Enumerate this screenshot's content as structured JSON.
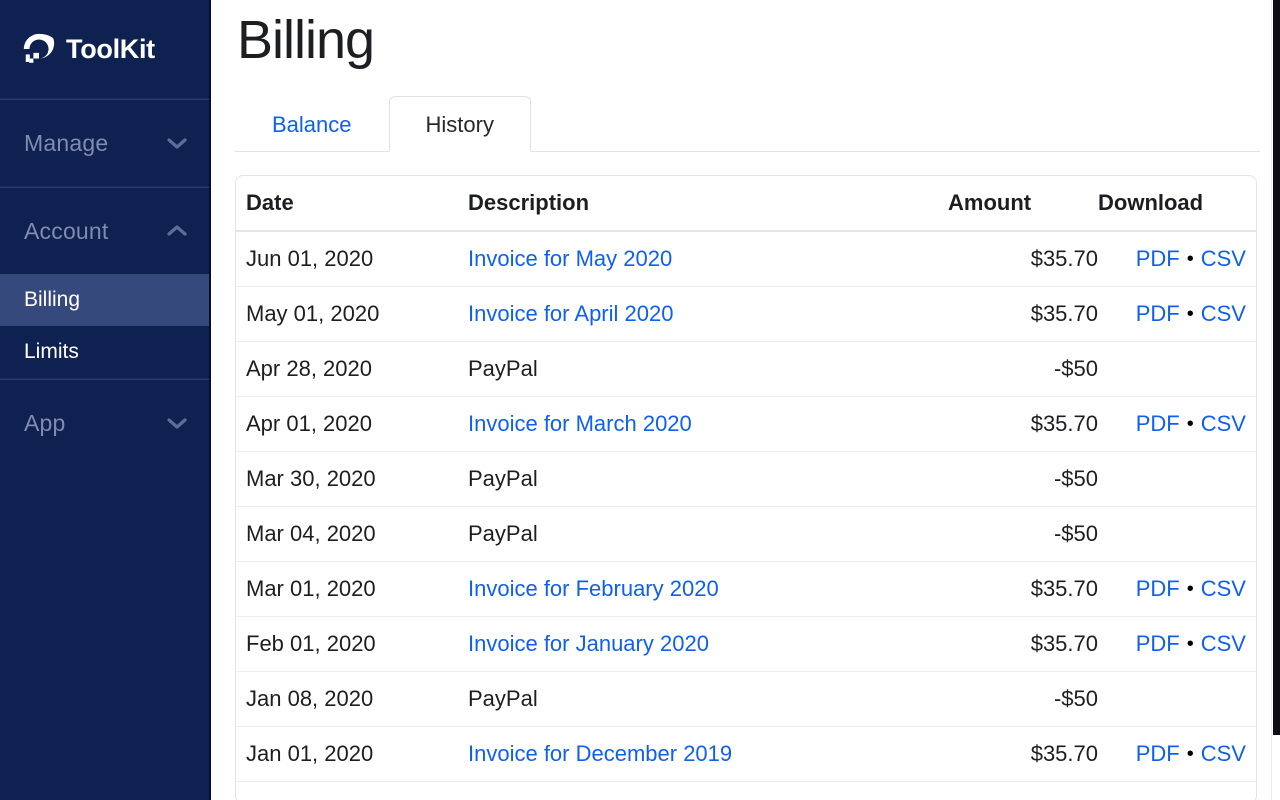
{
  "brand": {
    "name": "ToolKit",
    "logo_icon": "digitalocean-logo-icon"
  },
  "sidebar": {
    "groups": [
      {
        "label": "Manage",
        "icon": "chevron-down-icon",
        "expanded": false,
        "items": []
      },
      {
        "label": "Account",
        "icon": "chevron-up-icon",
        "expanded": true,
        "items": [
          {
            "label": "Billing",
            "active": true
          },
          {
            "label": "Limits",
            "active": false
          }
        ]
      },
      {
        "label": "App",
        "icon": "chevron-down-icon",
        "expanded": false,
        "items": []
      }
    ]
  },
  "page": {
    "title": "Billing"
  },
  "tabs": [
    {
      "label": "Balance",
      "active": false
    },
    {
      "label": "History",
      "active": true
    }
  ],
  "table": {
    "columns": [
      "Date",
      "Description",
      "Amount",
      "Download"
    ],
    "download_separator": "•",
    "rows": [
      {
        "date": "Jun 01, 2020",
        "description": "Invoice for May 2020",
        "description_link": true,
        "amount": "$35.70",
        "pdf": "PDF",
        "csv": "CSV"
      },
      {
        "date": "May 01, 2020",
        "description": "Invoice for April 2020",
        "description_link": true,
        "amount": "$35.70",
        "pdf": "PDF",
        "csv": "CSV"
      },
      {
        "date": "Apr 28, 2020",
        "description": "PayPal",
        "description_link": false,
        "amount": "-$50",
        "pdf": "",
        "csv": ""
      },
      {
        "date": "Apr 01, 2020",
        "description": "Invoice for March 2020",
        "description_link": true,
        "amount": "$35.70",
        "pdf": "PDF",
        "csv": "CSV"
      },
      {
        "date": "Mar 30, 2020",
        "description": "PayPal",
        "description_link": false,
        "amount": "-$50",
        "pdf": "",
        "csv": ""
      },
      {
        "date": "Mar 04, 2020",
        "description": "PayPal",
        "description_link": false,
        "amount": "-$50",
        "pdf": "",
        "csv": ""
      },
      {
        "date": "Mar 01, 2020",
        "description": "Invoice for February 2020",
        "description_link": true,
        "amount": "$35.70",
        "pdf": "PDF",
        "csv": "CSV"
      },
      {
        "date": "Feb 01, 2020",
        "description": "Invoice for January 2020",
        "description_link": true,
        "amount": "$35.70",
        "pdf": "PDF",
        "csv": "CSV"
      },
      {
        "date": "Jan 08, 2020",
        "description": "PayPal",
        "description_link": false,
        "amount": "-$50",
        "pdf": "",
        "csv": ""
      },
      {
        "date": "Jan 01, 2020",
        "description": "Invoice for December 2019",
        "description_link": true,
        "amount": "$35.70",
        "pdf": "PDF",
        "csv": "CSV"
      }
    ]
  },
  "colors": {
    "sidebar_bg": "#0f2150",
    "sidebar_active": "#35497c",
    "sidebar_muted_text": "#7f8cb0",
    "link": "#1060f0",
    "text": "#1c1e21",
    "border": "#e2e5e9"
  }
}
